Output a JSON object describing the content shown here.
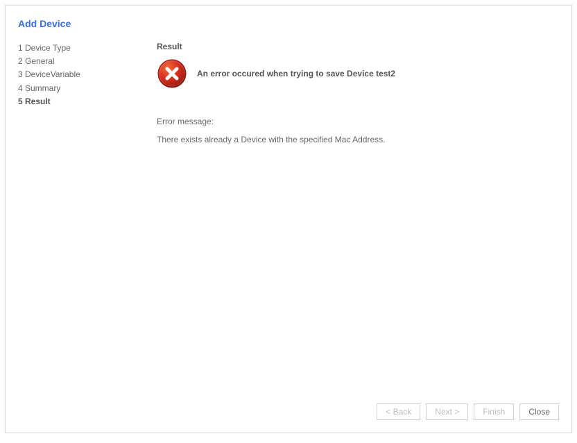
{
  "title": "Add Device",
  "steps": [
    {
      "label": "1 Device Type",
      "active": false
    },
    {
      "label": "2 General",
      "active": false
    },
    {
      "label": "3 DeviceVariable",
      "active": false
    },
    {
      "label": "4 Summary",
      "active": false
    },
    {
      "label": "5 Result",
      "active": true
    }
  ],
  "result": {
    "section_title": "Result",
    "heading": "An error occured when trying to save Device test2",
    "error_label": "Error message:",
    "error_detail": "There exists already a Device with the specified Mac Address."
  },
  "buttons": {
    "back": "< Back",
    "next": "Next >",
    "finish": "Finish",
    "close": "Close"
  }
}
